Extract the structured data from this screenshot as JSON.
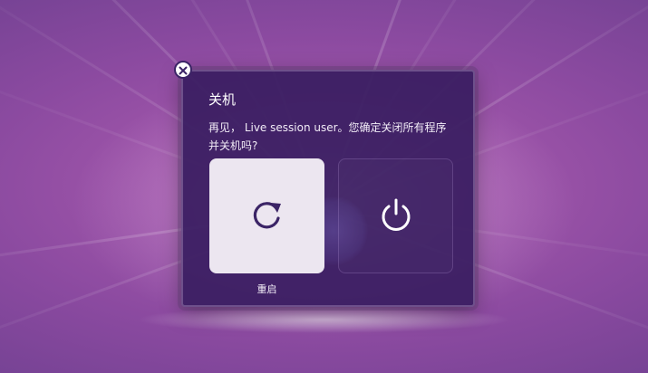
{
  "dialog": {
    "title": "关机",
    "message": "再见， Live session user。您确定关闭所有程序并关机吗?",
    "close_icon": "close-icon",
    "actions": [
      {
        "icon": "restart-icon",
        "label": "重启",
        "selected": true
      },
      {
        "icon": "power-icon",
        "label": "",
        "selected": false
      }
    ]
  },
  "colors": {
    "dialog_bg": "#3a1e62",
    "tile_selected": "#ece6f0",
    "icon_dark": "#3b2466",
    "desktop_accent": "#b15fb2"
  }
}
